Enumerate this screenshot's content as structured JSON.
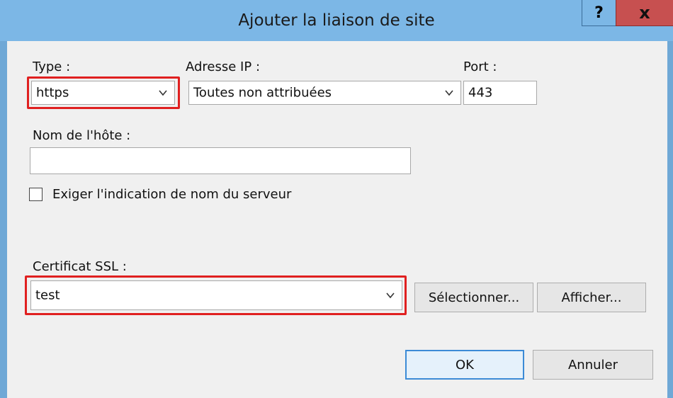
{
  "window": {
    "title": "Ajouter la liaison de site",
    "help_glyph": "?",
    "close_glyph": "x"
  },
  "type_field": {
    "label": "Type :",
    "value": "https"
  },
  "ip_field": {
    "label": "Adresse IP :",
    "value": "Toutes non attribuées"
  },
  "port_field": {
    "label": "Port :",
    "value": "443"
  },
  "host_field": {
    "label": "Nom de l'hôte :",
    "value": ""
  },
  "sni_checkbox": {
    "label": "Exiger l'indication de nom du serveur",
    "checked": false
  },
  "ssl_field": {
    "label": "Certificat SSL :",
    "value": "test"
  },
  "buttons": {
    "select": "Sélectionner...",
    "view": "Afficher...",
    "ok": "OK",
    "cancel": "Annuler"
  },
  "colors": {
    "highlight": "#e02020",
    "titlebar": "#7cb7e6",
    "close": "#c75050",
    "accent": "#3c8bd6"
  },
  "icons": [
    "chevron-down-icon",
    "help-icon",
    "close-icon"
  ]
}
